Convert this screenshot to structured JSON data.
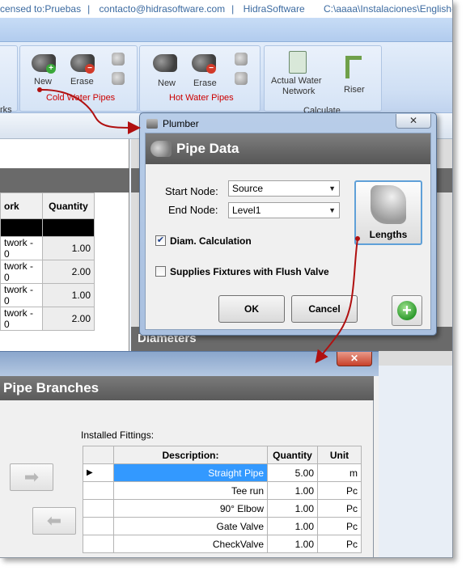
{
  "titlebar": {
    "license": "censed to:Pruebas",
    "contact": "contacto@hidrasoftware.com",
    "company": "HidraSoftware",
    "path": "C:\\aaaa\\Instalaciones\\English-"
  },
  "ribbon": {
    "cold_group_title": "Cold Water Pipes",
    "hot_group_title": "Hot Water Pipes",
    "calc_group_title": "Calculate",
    "left_group_title_fragment": "rks",
    "cold_new": "New",
    "cold_erase": "Erase",
    "hot_new": "New",
    "hot_erase": "Erase",
    "actual_water_network_line1": "Actual Water",
    "actual_water_network_line2": "Network",
    "riser": "Riser"
  },
  "grid1": {
    "col_name": "ork",
    "col_quantity": "Quantity",
    "rows": [
      {
        "name": "twork - 0",
        "qty": "1.00"
      },
      {
        "name": "twork - 0",
        "qty": "2.00"
      },
      {
        "name": "twork - 0",
        "qty": "1.00"
      },
      {
        "name": "twork - 0",
        "qty": "2.00"
      }
    ]
  },
  "right_pane": {
    "section_fragment": "Diameters"
  },
  "dialog": {
    "title": "Plumber",
    "header": "Pipe Data",
    "start_node_label": "Start Node:",
    "start_node_value": "Source",
    "end_node_label": "End Node:",
    "end_node_value": "Level1",
    "diam_calc_label": "Diam. Calculation",
    "diam_calc_checked": true,
    "flush_valve_label": "Supplies Fixtures with Flush Valve",
    "flush_valve_checked": false,
    "lengths_label": "Lengths",
    "ok_label": "OK",
    "cancel_label": "Cancel",
    "close_glyph": "✕"
  },
  "branches": {
    "header": "Pipe Branches",
    "installed_label": "Installed Fittings:",
    "close_glyph": "✕",
    "columns": [
      "Description:",
      "Quantity",
      "Unit"
    ],
    "rows": [
      {
        "desc": "Straight Pipe",
        "qty": "5.00",
        "unit": "m"
      },
      {
        "desc": "Tee run",
        "qty": "1.00",
        "unit": "Pc"
      },
      {
        "desc": "90° Elbow",
        "qty": "1.00",
        "unit": "Pc"
      },
      {
        "desc": "Gate Valve",
        "qty": "1.00",
        "unit": "Pc"
      },
      {
        "desc": "CheckValve",
        "qty": "1.00",
        "unit": "Pc"
      }
    ]
  },
  "colors": {
    "selection": "#3399ff",
    "annotation": "#b01010",
    "ribbon_title_red": "#cc0000"
  }
}
